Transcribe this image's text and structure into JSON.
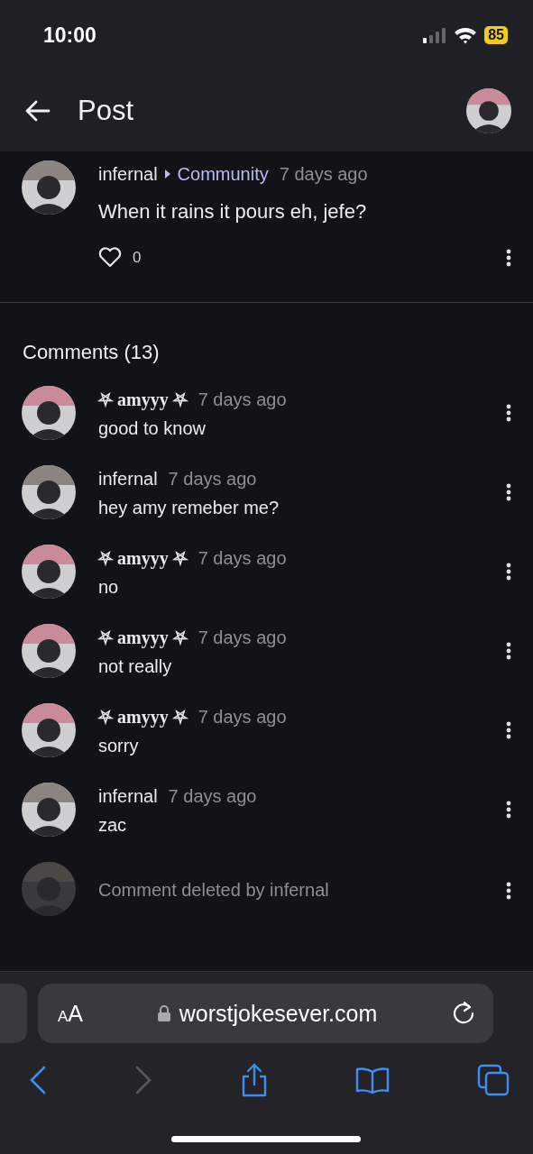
{
  "status_bar": {
    "time": "10:00",
    "battery": "85"
  },
  "header": {
    "title": "Post",
    "avatar": {
      "color": "#c98a9a"
    }
  },
  "post": {
    "author": "infernal",
    "avatar": {
      "color": "#8a8580"
    },
    "community": "Community",
    "time": "7 days ago",
    "text": "When it rains it pours eh, jefe?",
    "likes": "0"
  },
  "comments_heading": "Comments (13)",
  "comments": [
    {
      "kind": "comment",
      "author": "⛧ amyyy ⛧",
      "decorated": true,
      "avatar": {
        "color": "#c98a9a"
      },
      "time": "7 days ago",
      "text": "good to know"
    },
    {
      "kind": "comment",
      "author": "infernal",
      "decorated": false,
      "avatar": {
        "color": "#8a8580"
      },
      "time": "7 days ago",
      "text": "hey amy remeber me?"
    },
    {
      "kind": "comment",
      "author": "⛧ amyyy ⛧",
      "decorated": true,
      "avatar": {
        "color": "#c98a9a"
      },
      "time": "7 days ago",
      "text": "no"
    },
    {
      "kind": "comment",
      "author": "⛧ amyyy ⛧",
      "decorated": true,
      "avatar": {
        "color": "#c98a9a"
      },
      "time": "7 days ago",
      "text": "not really"
    },
    {
      "kind": "comment",
      "author": "⛧ amyyy ⛧",
      "decorated": true,
      "avatar": {
        "color": "#c98a9a"
      },
      "time": "7 days ago",
      "text": "sorry"
    },
    {
      "kind": "comment",
      "author": "infernal",
      "decorated": false,
      "avatar": {
        "color": "#8a8580"
      },
      "time": "7 days ago",
      "text": "zac"
    },
    {
      "kind": "deleted",
      "avatar": {
        "color": "#4a4744"
      },
      "text": "Comment deleted by infernal"
    }
  ],
  "browser": {
    "text_size": "AA",
    "url": "worstjokesever.com",
    "back_disabled": false,
    "forward_disabled": true
  }
}
